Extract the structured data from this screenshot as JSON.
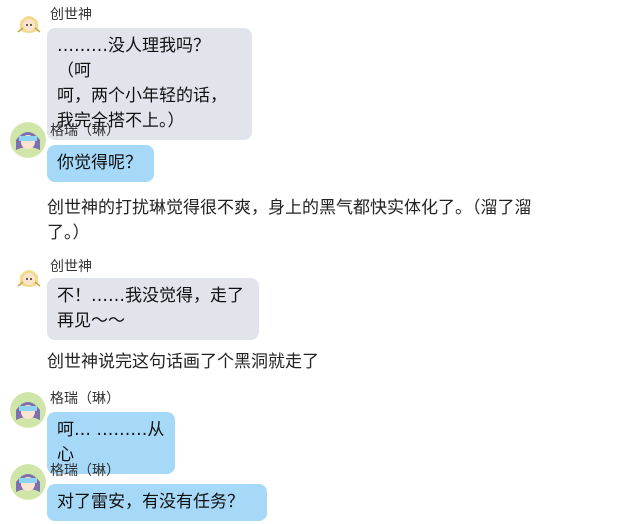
{
  "messages": [
    {
      "sender": "创世神",
      "text": "………没人理我吗？（呵\n呵，两个小年轻的话，\n我完全搭不上。）",
      "style": "grey"
    },
    {
      "sender": "格瑞（琳）",
      "text": "你觉得呢？",
      "style": "blue"
    },
    {
      "narration": "创世神的打扰琳觉得很不爽，身上的黑气都快实体化了。（溜了溜\n了。）"
    },
    {
      "sender": "创世神",
      "text": "不！……我没觉得，走了\n再见～～",
      "style": "grey"
    },
    {
      "narration": "创世神说完这句话画了个黑洞就走了"
    },
    {
      "sender": "格瑞（琳）",
      "text": "呵… ………从心",
      "style": "blue"
    },
    {
      "sender": "格瑞（琳）",
      "text": "对了雷安，有没有任务？",
      "style": "blue"
    }
  ],
  "colors": {
    "bubble_grey": "#e2e4ec",
    "bubble_blue": "#a6d8f7"
  },
  "icons": {
    "creator_avatar": "anime-girl-avatar-icon",
    "grey_avatar": "anime-boy-avatar-icon"
  }
}
